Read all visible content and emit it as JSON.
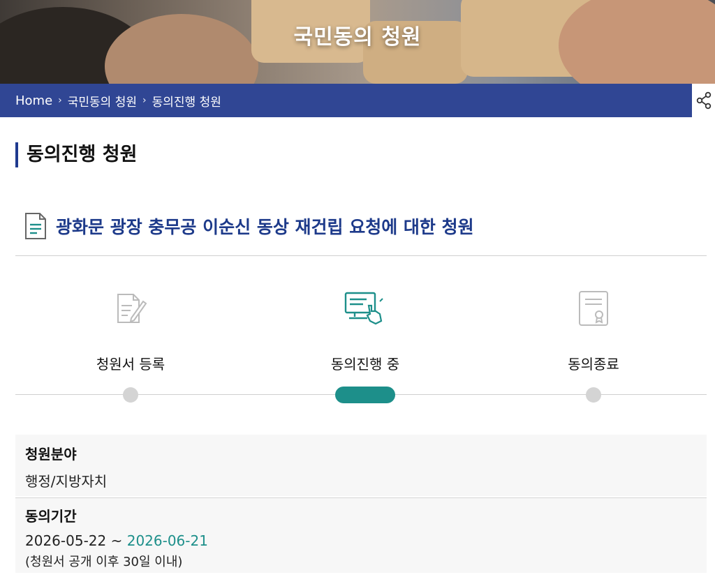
{
  "hero": {
    "title": "국민동의 청원"
  },
  "breadcrumb": {
    "home": "Home",
    "items": [
      "국민동의 청원",
      "동의진행 청원"
    ],
    "separator": "›"
  },
  "page": {
    "title": "동의진행 청원"
  },
  "petition": {
    "title": "광화문 광장 충무공 이순신 동상 재건립 요청에 대한 청원"
  },
  "progress": {
    "steps": [
      {
        "label": "청원서 등록",
        "icon": "document-pen-icon",
        "active": false
      },
      {
        "label": "동의진행 중",
        "icon": "computer-click-icon",
        "active": true
      },
      {
        "label": "동의종료",
        "icon": "certificate-icon",
        "active": false
      }
    ]
  },
  "details": {
    "category": {
      "label": "청원분야",
      "value": "행정/지방자치"
    },
    "period": {
      "label": "동의기간",
      "start": "2026-05-22",
      "separator": " ~ ",
      "end": "2026-06-21",
      "note": "(청원서 공개 이후 30일 이내)"
    }
  },
  "colors": {
    "brand_blue": "#1f3a8f",
    "accent_teal": "#1d8f8a",
    "inactive_gray": "#d4d4d4"
  }
}
